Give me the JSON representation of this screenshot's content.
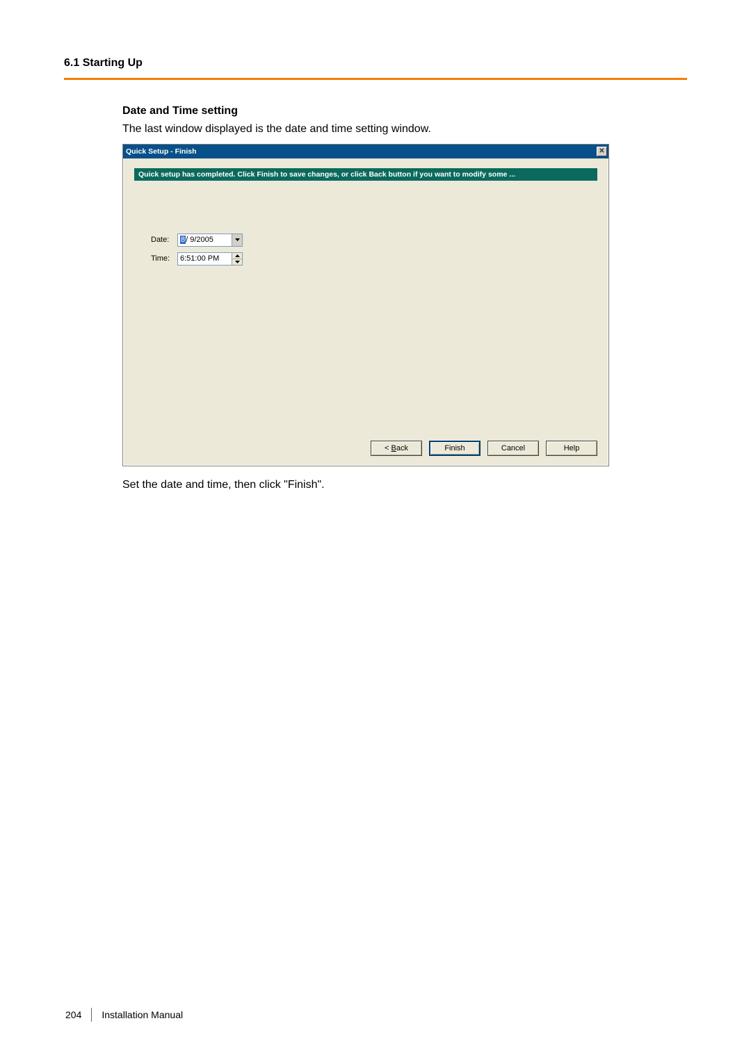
{
  "header": {
    "section_number_title": "6.1 Starting Up"
  },
  "body": {
    "sub_heading": "Date and Time setting",
    "intro_text": "The last window displayed is the date and time setting window.",
    "after_text": "Set the date and time, then click \"Finish\"."
  },
  "dialog": {
    "title": "Quick Setup - Finish",
    "close_glyph": "✕",
    "message": "Quick setup has completed. Click Finish to save changes, or click Back button if you want to modify some ...",
    "date_label": "Date:",
    "date_value_prefix": "8",
    "date_value_rest": "/ 9/2005",
    "time_label": "Time:",
    "time_value": " 6:51:00 PM",
    "buttons": {
      "back": "< Back",
      "finish": "Finish",
      "cancel": "Cancel",
      "help": "Help"
    }
  },
  "footer": {
    "page_number": "204",
    "doc_title": "Installation Manual"
  }
}
